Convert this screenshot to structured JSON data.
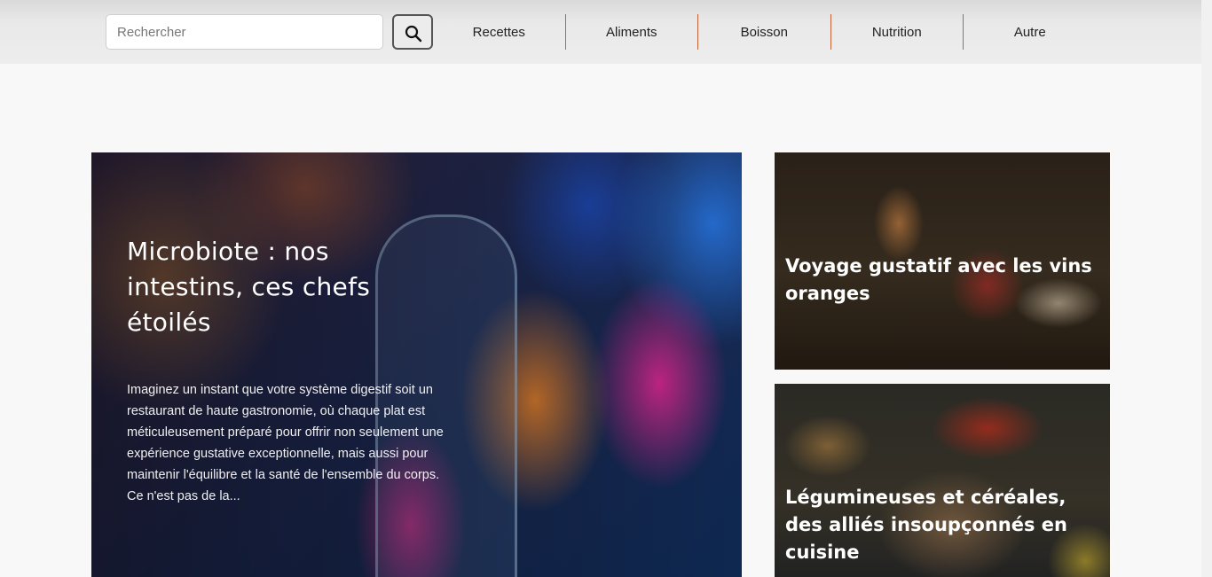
{
  "header": {
    "search": {
      "placeholder": "Rechercher",
      "value": ""
    },
    "search_icon": "search-icon",
    "nav": [
      {
        "label": "Recettes"
      },
      {
        "label": "Aliments"
      },
      {
        "label": "Boisson"
      },
      {
        "label": "Nutrition"
      },
      {
        "label": "Autre"
      }
    ]
  },
  "featured": {
    "title": "Microbiote : nos intestins, ces chefs étoilés",
    "excerpt": "Imaginez un instant que votre système digestif soit un restaurant de haute gastronomie, où chaque plat est méticuleusement préparé pour offrir non seulement une expérience gustative exceptionnelle, mais aussi pour maintenir l'équilibre et la santé de l'ensemble du corps. Ce n'est pas de la..."
  },
  "side_articles": [
    {
      "title": "Voyage gustatif avec les vins oranges"
    },
    {
      "title": "Légumineuses et céréales, des alliés insoupçonnés en cuisine"
    }
  ],
  "colors": {
    "nav_divider": "#c0623a",
    "header_bg": "#e9e9e9",
    "page_bg": "#f8f8f8"
  }
}
